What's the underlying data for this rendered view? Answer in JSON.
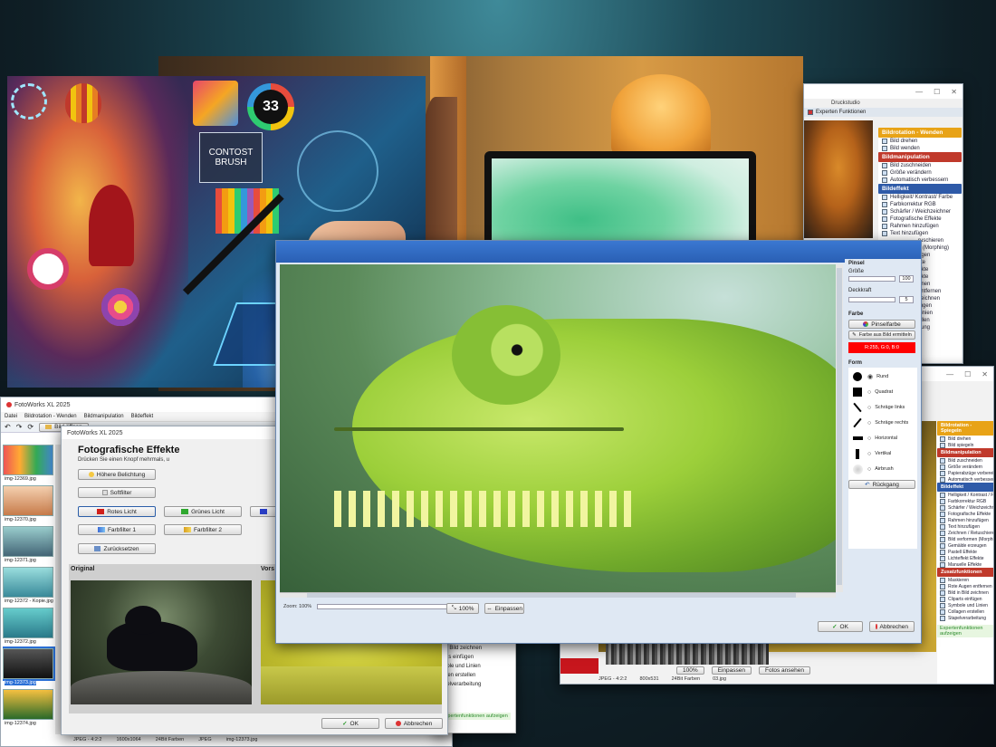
{
  "main_window": {
    "title": "FotoWorks XL 2025",
    "menu": [
      "Datei",
      "Bildrotation - Wenden",
      "Bildmanipulation",
      "Bildeffekt"
    ],
    "open_button": "Bild öffnen",
    "thumbnails": [
      "img-12369.jpg",
      "img-12370.jpg",
      "img-12371.jpg",
      "img-12372 - Kopie.jpg",
      "img-12372.jpg",
      "img-12373.jpg",
      "img-12374.jpg"
    ],
    "status": [
      "JPEG - 4:2:2",
      "1600x1064",
      "24Bit Farben",
      "JPEG",
      "img-12373.jpg"
    ]
  },
  "effects_dialog": {
    "title": "FotoWorks XL 2025",
    "heading": "Fotografische Effekte",
    "instruction": "Drücken Sie einen Knopf mehrmals, u",
    "buttons": {
      "hoehere_belichtung": "Höhere Belichtung",
      "softfilter": "Softfilter",
      "rotes_licht": "Rotes Licht",
      "gruenes_licht": "Grünes Licht",
      "farbfilter1": "Farbfilter 1",
      "farbfilter2": "Farbfilter 2",
      "zuruecksetzen": "Zurücksetzen",
      "ok": "OK",
      "abbrechen": "Abbrechen"
    },
    "original_label": "Original",
    "preview_label": "Vors"
  },
  "back_right_window": {
    "tab": "Druckstudio",
    "experten": "Experten Funktionen",
    "sections": [
      {
        "title": "Bildrotation - Wenden",
        "color": "#e8a317",
        "items": [
          "Bild drehen",
          "Bild wenden"
        ]
      },
      {
        "title": "Bildmanipulation",
        "color": "#c0392b",
        "items": [
          "Bild zuschneiden",
          "Größe verändern",
          "Automatisch verbessern"
        ]
      },
      {
        "title": "Bildeffekt",
        "color": "#2e5aa8",
        "items": [
          "Helligkeit/ Kontrast/ Farbe",
          "Farbkorrektur RGB",
          "Schärfer / Weichzeichner",
          "Fotografische Effekte",
          "Rahmen hinzufügen",
          "Text hinzufügen"
        ]
      }
    ],
    "partial_items": [
      "ruschieren",
      "n (Morphing)",
      "ugen",
      "kte",
      "ekte",
      "ekte",
      "hnen",
      "entfernen",
      "zeichnen",
      "fügen",
      "Linien",
      "ellen",
      "itung"
    ]
  },
  "mid_lower_window": {
    "partial_items": [
      "d in Bild zeichnen",
      "parts einfügen",
      "mbole und Linien",
      "llagen erstellen",
      "tapelverarbeitung"
    ],
    "experten": "Expertenfunktionen aufzeigen"
  },
  "right_lower_window": {
    "sections": [
      {
        "title": "Bildrotation - Spiegeln",
        "color": "#e8a317",
        "items": [
          "Bild drehen",
          "Bild spiegeln"
        ]
      },
      {
        "title": "Bildmanipulation",
        "color": "#c0392b",
        "items": [
          "Bild zuschneiden",
          "Größe verändern",
          "Papierabzüge vorbereiten",
          "Automatisch verbessern"
        ]
      },
      {
        "title": "Bildeffekt",
        "color": "#2e5aa8",
        "items": [
          "Helligkeit / Kontrast / Farbe",
          "Farbkorrektur RGB",
          "Schärfer / Weichzeichner",
          "Fotografische Effekte",
          "Rahmen hinzufügen",
          "Text hinzufügen",
          "Zeichnen / Retuschieren",
          "Bild verformen (Morphing)",
          "Gemälde erzeugen",
          "Pastell Effekte",
          "Lichteffekt Effekte",
          "Manuelle Effekte"
        ]
      },
      {
        "title": "Zusatzfunktionen",
        "color": "#c0392b",
        "items": [
          "Maskieren",
          "Rote Augen entfernen",
          "Bild in Bild zeichnen",
          "Cliparts einfügen",
          "Symbole und Linien",
          "Collagen erstellen",
          "Stapelverarbeitung"
        ]
      }
    ],
    "experten": "Expertenfunktionen aufzeigen",
    "zoom_buttons": [
      "100%",
      "Einpassen",
      "Fotos ansehen"
    ],
    "status": [
      "JPEG - 4:2:2",
      "800x531",
      "24Bit Farben",
      "03.jpg"
    ]
  },
  "brush_window": {
    "pinsel": "Pinsel",
    "groesse": "Größe",
    "groesse_value": "100",
    "deckkraft": "Deckkraft",
    "deckkraft_value": "5",
    "farbe": "Farbe",
    "pinselfarbe": "Pinselfarbe",
    "farbe_aus_bild": "Farbe aus Bild ermitteln",
    "color_value": "R:255, G:0, B:0",
    "form": "Form",
    "forms": [
      "Rund",
      "Quadrat",
      "Schräge links",
      "Schräge rechts",
      "Horizontal",
      "Vertikal",
      "Airbrush"
    ],
    "rueckgang": "Rückgang",
    "zoom_label": "Zoom: 100%",
    "zoom_100": "100%",
    "einpassen": "Einpassen",
    "ok": "OK",
    "abbrechen": "Abbrechen"
  },
  "ai_art": {
    "badge_number": "33",
    "contrast_text": "CONTOST BRUSH"
  }
}
